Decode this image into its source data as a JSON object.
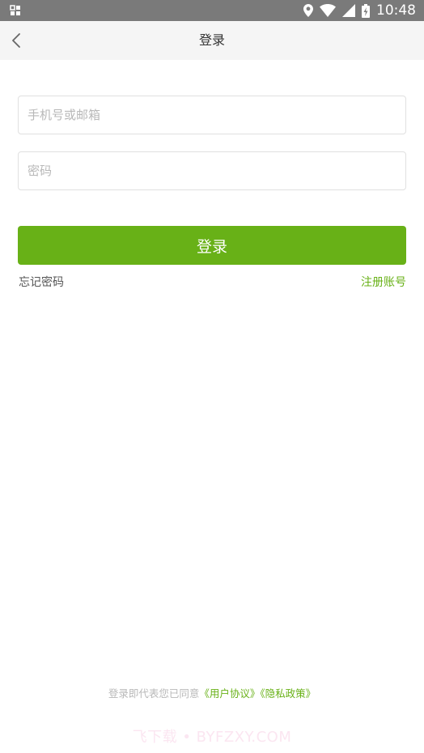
{
  "status_bar": {
    "time": "10:48",
    "icons": [
      "notification-grid-icon",
      "location-icon",
      "wifi-icon",
      "signal-icon",
      "battery-charging-icon"
    ]
  },
  "nav": {
    "title": "登录",
    "back_icon": "chevron-left-icon"
  },
  "form": {
    "phone_placeholder": "手机号或邮箱",
    "phone_value": "",
    "password_placeholder": "密码",
    "password_value": "",
    "login_label": "登录"
  },
  "links": {
    "forgot": "忘记密码",
    "register": "注册账号"
  },
  "agreement": {
    "prefix": "登录即代表您已同意",
    "user_agreement": "《用户协议》",
    "privacy_policy": "《隐私政策》"
  },
  "watermark": "飞下载 • BYFZXY.COM",
  "colors": {
    "accent": "#68b117",
    "status_bar": "#7a7a7a",
    "nav_bg": "#f5f5f5",
    "placeholder": "#b8b8b8"
  }
}
